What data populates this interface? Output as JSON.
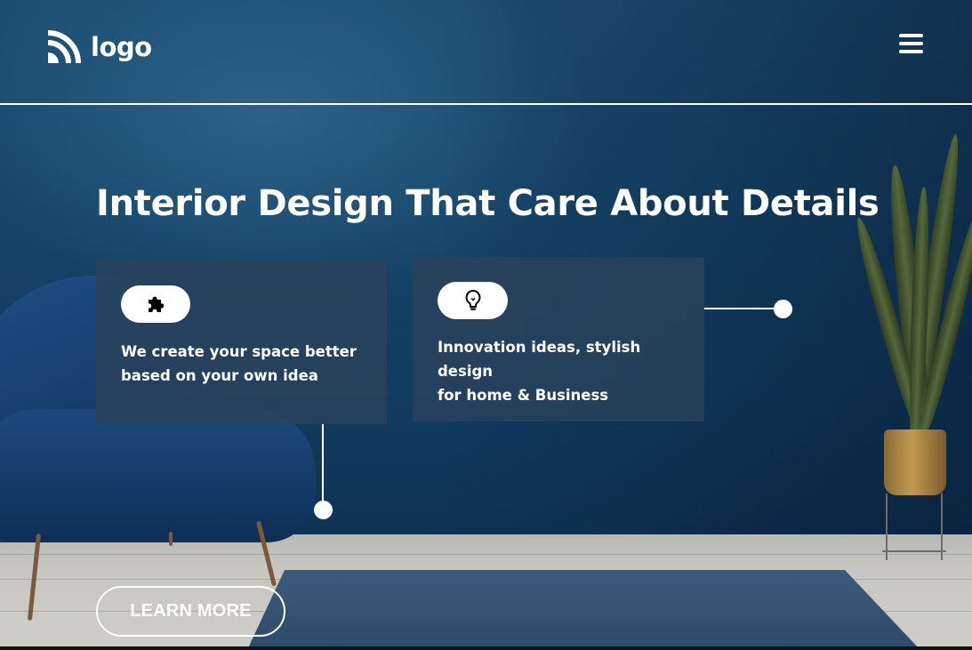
{
  "header": {
    "logo_text": "logo",
    "logo_icon": "signal-arcs-icon",
    "menu_icon": "hamburger-menu-icon"
  },
  "hero": {
    "title": "Interior Design That Care About Details",
    "cards": [
      {
        "icon": "puzzle-piece-icon",
        "text": "We create your space better based on your own idea"
      },
      {
        "icon": "lightbulb-icon",
        "text_lines": [
          "Innovation ideas, stylish",
          "design",
          "for home & Business"
        ]
      }
    ],
    "cta_label": "LEARN MORE"
  },
  "colors": {
    "wall": "#154468",
    "card_bg": "#2a425c",
    "floor": "#c7c6c0",
    "rug": "#2e4a6a",
    "text": "#ffffff"
  }
}
